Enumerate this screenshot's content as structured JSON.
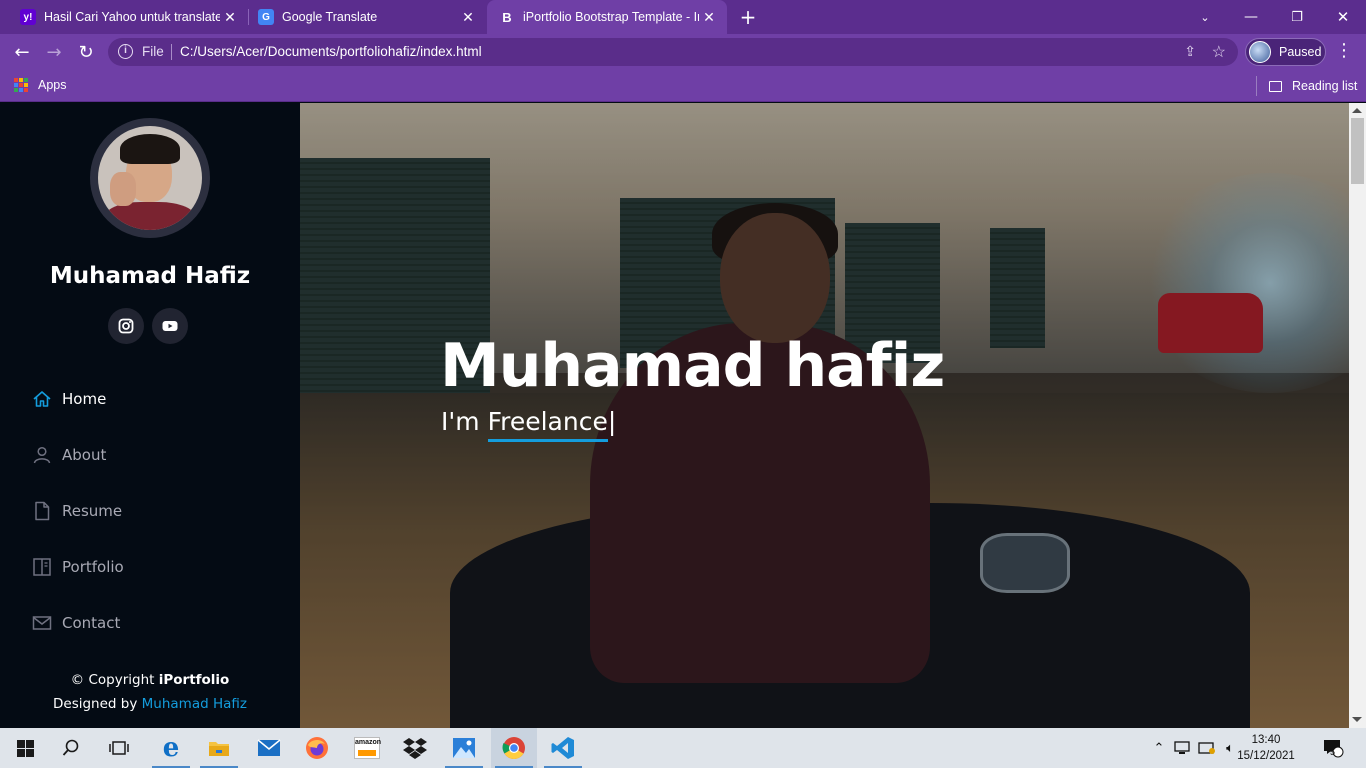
{
  "browser": {
    "tabs": [
      {
        "title": "Hasil Cari Yahoo untuk translate",
        "favicon": "yahoo-icon",
        "active": false
      },
      {
        "title": "Google Translate",
        "favicon": "google-translate-icon",
        "active": false
      },
      {
        "title": "iPortfolio Bootstrap Template - Ir",
        "favicon": "bootstrap-icon",
        "active": true
      }
    ],
    "new_tab_label": "+",
    "address": {
      "scheme_label": "File",
      "url": "C:/Users/Acer/Documents/portfoliohafiz/index.html"
    },
    "profile_status": "Paused",
    "bookmarks": {
      "apps_label": "Apps",
      "reading_list_label": "Reading list"
    },
    "theme_color": "#6f3fa6"
  },
  "sidebar": {
    "name": "Muhamad Hafiz",
    "social": [
      {
        "icon": "instagram-icon"
      },
      {
        "icon": "youtube-icon"
      }
    ],
    "nav": [
      {
        "label": "Home",
        "icon": "home-icon",
        "active": true
      },
      {
        "label": "About",
        "icon": "person-icon",
        "active": false
      },
      {
        "label": "Resume",
        "icon": "file-icon",
        "active": false
      },
      {
        "label": "Portfolio",
        "icon": "book-icon",
        "active": false
      },
      {
        "label": "Contact",
        "icon": "envelope-icon",
        "active": false
      }
    ],
    "footer": {
      "copyright_prefix": "© Copyright",
      "brand": "iPortfolio",
      "designed_prefix": "Designed by",
      "designer": "Muhamad Hafiz"
    },
    "accent_color": "#149ddd"
  },
  "hero": {
    "title": "Muhamad hafiz",
    "subtitle_prefix": "I'm",
    "typed_text": "Freelance",
    "cursor": "|"
  },
  "taskbar": {
    "apps": [
      "start-icon",
      "search-icon",
      "task-view-icon",
      "edge-icon",
      "file-explorer-icon",
      "mail-icon",
      "firefox-icon",
      "amazon-icon",
      "dropbox-icon",
      "photos-icon",
      "chrome-icon",
      "vscode-icon"
    ],
    "time": "13:40",
    "date": "15/12/2021",
    "notification_count": "5"
  }
}
